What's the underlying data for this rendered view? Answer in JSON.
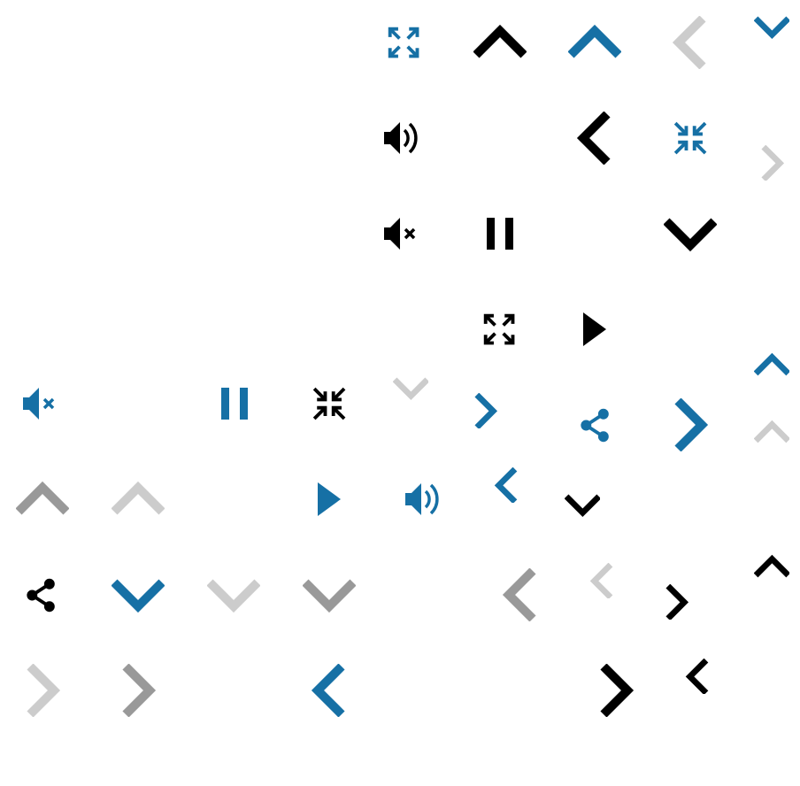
{
  "colors": {
    "black": "#000000",
    "blue": "#1670a5",
    "gray": "#999999",
    "light": "#cccccc"
  },
  "icons": [
    {
      "type": "expand",
      "color": "blue"
    },
    {
      "type": "chevron-up",
      "color": "black"
    },
    {
      "type": "chevron-up",
      "color": "blue"
    },
    {
      "type": "chevron-left",
      "color": "light"
    },
    {
      "type": "chevron-down",
      "color": "blue",
      "small": true
    },
    {
      "type": "volume",
      "color": "black"
    },
    {
      "type": "chevron-left",
      "color": "black"
    },
    {
      "type": "compress",
      "color": "blue"
    },
    {
      "type": "chevron-right",
      "color": "light",
      "small": true
    },
    {
      "type": "mute",
      "color": "black"
    },
    {
      "type": "pause",
      "color": "black"
    },
    {
      "type": "chevron-down",
      "color": "black"
    },
    {
      "type": "expand",
      "color": "black"
    },
    {
      "type": "play",
      "color": "black"
    },
    {
      "type": "chevron-up",
      "color": "blue",
      "small": true
    },
    {
      "type": "mute",
      "color": "blue"
    },
    {
      "type": "pause",
      "color": "blue"
    },
    {
      "type": "compress",
      "color": "black"
    },
    {
      "type": "chevron-down",
      "color": "light",
      "small": true
    },
    {
      "type": "chevron-right",
      "color": "blue",
      "small": true
    },
    {
      "type": "share",
      "color": "blue"
    },
    {
      "type": "chevron-right",
      "color": "blue"
    },
    {
      "type": "chevron-up",
      "color": "light",
      "small": true
    },
    {
      "type": "chevron-up",
      "color": "gray"
    },
    {
      "type": "chevron-up",
      "color": "light"
    },
    {
      "type": "play",
      "color": "blue"
    },
    {
      "type": "volume",
      "color": "blue"
    },
    {
      "type": "chevron-left",
      "color": "blue",
      "small": true
    },
    {
      "type": "chevron-down",
      "color": "black",
      "small": true
    },
    {
      "type": "share",
      "color": "black"
    },
    {
      "type": "chevron-down",
      "color": "blue"
    },
    {
      "type": "chevron-down",
      "color": "light"
    },
    {
      "type": "chevron-down",
      "color": "gray"
    },
    {
      "type": "chevron-left",
      "color": "gray"
    },
    {
      "type": "chevron-left",
      "color": "light",
      "small": true
    },
    {
      "type": "chevron-right",
      "color": "black",
      "small": true
    },
    {
      "type": "chevron-up",
      "color": "black",
      "small": true
    },
    {
      "type": "chevron-right",
      "color": "light"
    },
    {
      "type": "chevron-right",
      "color": "gray"
    },
    {
      "type": "chevron-left",
      "color": "blue"
    },
    {
      "type": "chevron-right",
      "color": "black"
    },
    {
      "type": "chevron-left",
      "color": "black",
      "small": true
    }
  ]
}
